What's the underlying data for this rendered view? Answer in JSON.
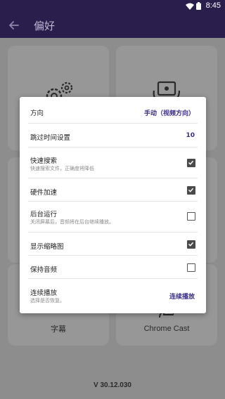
{
  "status_bar": {
    "time": "8:45"
  },
  "app_bar": {
    "title": "偏好"
  },
  "tiles": {
    "subtitles_label": "字幕",
    "chromecast_label": "Chrome Cast"
  },
  "version": "V 30.12.030",
  "dialog": {
    "orientation": {
      "label": "方向",
      "value": "手动（视频方向）"
    },
    "seek_time": {
      "label": "跳过时间设置",
      "value": "10"
    },
    "quick_search": {
      "label": "快速搜索",
      "sub": "快速搜索文件，正确度将降低",
      "checked": true
    },
    "hw_accel": {
      "label": "硬件加速",
      "checked": true
    },
    "background_play": {
      "label": "后台运行",
      "sub": "关闭屏幕后，音频将在后台继续播放。",
      "checked": false
    },
    "show_thumbnails": {
      "label": "显示缩略图",
      "checked": true
    },
    "keep_audio": {
      "label": "保持音频",
      "checked": false
    },
    "continuous_play": {
      "label": "连续播放",
      "sub": "选择是否恢复。",
      "value": "连续播放"
    }
  },
  "colors": {
    "app_bar": "#2a1f4c",
    "accent": "#3a2e86"
  }
}
